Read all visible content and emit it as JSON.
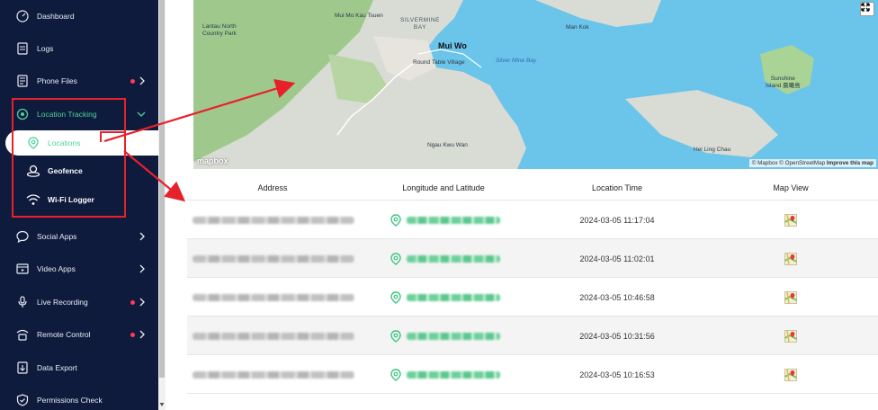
{
  "sidebar": {
    "items": [
      {
        "label": "Dashboard",
        "icon": "dashboard-icon"
      },
      {
        "label": "Logs",
        "icon": "logs-icon"
      },
      {
        "label": "Phone Files",
        "icon": "phone-files-icon",
        "dot": true,
        "chevron": true
      },
      {
        "label": "Location Tracking",
        "icon": "location-tracking-icon",
        "expanded": true
      },
      {
        "label": "Social Apps",
        "icon": "social-apps-icon",
        "chevron": true
      },
      {
        "label": "Video Apps",
        "icon": "video-apps-icon",
        "chevron": true
      },
      {
        "label": "Live Recording",
        "icon": "live-recording-icon",
        "dot": true,
        "chevron": true
      },
      {
        "label": "Remote Control",
        "icon": "remote-control-icon",
        "dot": true,
        "chevron": true
      },
      {
        "label": "Data Export",
        "icon": "data-export-icon"
      },
      {
        "label": "Permissions Check",
        "icon": "permissions-check-icon"
      }
    ],
    "sub_items": [
      {
        "label": "Locations",
        "icon": "location-pin-icon",
        "selected": true
      },
      {
        "label": "Geofence",
        "icon": "geofence-icon"
      },
      {
        "label": "Wi-Fi Logger",
        "icon": "wifi-icon"
      }
    ]
  },
  "map": {
    "labels": {
      "lantau": "Lantau North\nCountry Park",
      "mui_mo_kau_tsuen": "Mui Mo Kau Tsuen",
      "silvermine": "SILVERMINE\nBAY",
      "mui_wo": "Mui Wo",
      "round_table": "Round Table Village",
      "silver_mine_bay": "Silver Mine Bay",
      "man_kok": "Man Kok",
      "sunshine": "Sunshine\nIsland 晨曦島",
      "ngau_kwu_wan": "Ngau Kwu Wan",
      "hei_ling_chau": "Hei Ling Chau"
    },
    "logo_text": "mapbox",
    "attribution": {
      "mapbox": "© Mapbox",
      "osm": "© OpenStreetMap",
      "improve": "Improve this map"
    }
  },
  "table": {
    "headers": {
      "address": "Address",
      "coords": "Longitude and Latitude",
      "time": "Location Time",
      "mapview": "Map View"
    },
    "rows": [
      {
        "time": "2024-03-05 11:17:04"
      },
      {
        "time": "2024-03-05 11:02:01"
      },
      {
        "time": "2024-03-05 10:46:58"
      },
      {
        "time": "2024-03-05 10:31:56"
      },
      {
        "time": "2024-03-05 10:16:53"
      }
    ]
  },
  "colors": {
    "sidebar_bg": "#0f1b3d",
    "accent_green": "#4ed39a",
    "annotation_red": "#e8202a",
    "dot_red": "#ff3b57"
  }
}
